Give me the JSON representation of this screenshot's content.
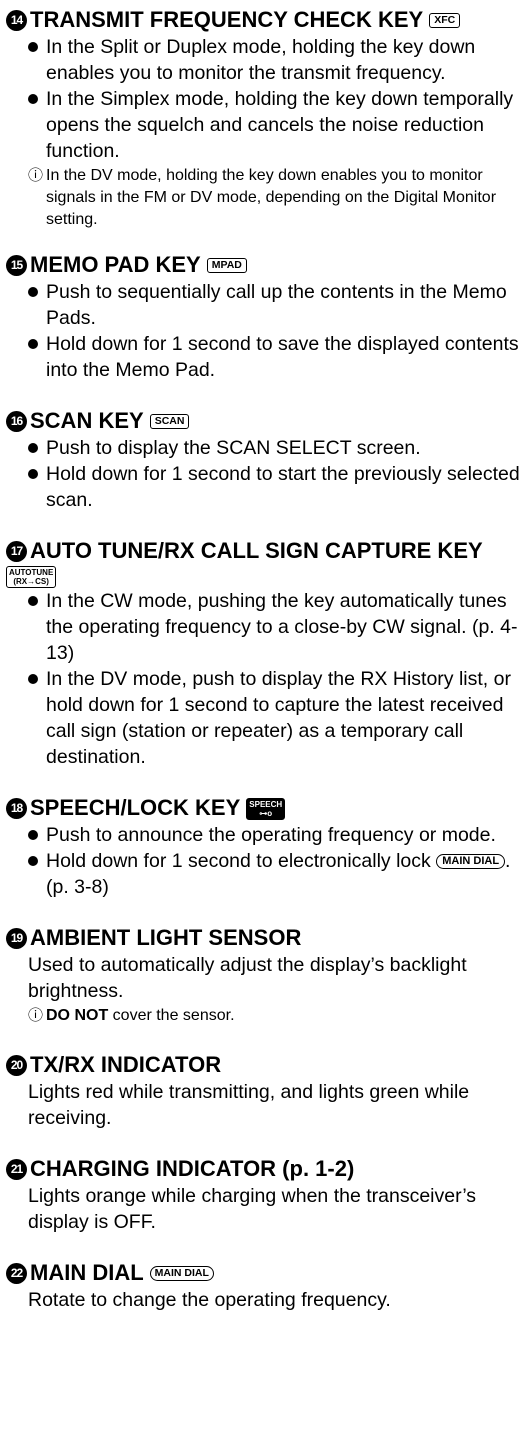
{
  "sections": [
    {
      "number": "14",
      "title": "TRANSMIT FREQUENCY CHECK KEY",
      "key": "XFC",
      "bullets": [
        "In the Split or Duplex mode, holding the key down enables you to monitor the transmit frequency.",
        "In the Simplex mode, holding the key down temporally opens the squelch and cancels the noise reduction function."
      ],
      "note": "In the DV mode, holding the key down enables you to monitor signals in the FM or DV mode, depending on the Digital Monitor setting."
    },
    {
      "number": "15",
      "title": "MEMO PAD KEY",
      "key": "MPAD",
      "bullets": [
        "Push to sequentially call up the contents in the Memo Pads.",
        "Hold down for 1 second to save the displayed contents into the Memo Pad."
      ]
    },
    {
      "number": "16",
      "title": "SCAN KEY",
      "key": "SCAN",
      "bullets": [
        "Push to display the SCAN SELECT screen.",
        "Hold down for 1 second to start the previously selected scan."
      ]
    },
    {
      "number": "17",
      "title": "AUTO TUNE/RX CALL SIGN CAPTURE KEY",
      "key_top": "AUTOTUNE",
      "key_bottom": "(RX→CS)",
      "bullets": [
        "In the CW mode, pushing the key automatically tunes the operating frequency to a close-by CW signal. (p. 4-13)",
        "In the DV mode, push to display the RX History list, or hold down for 1 second to capture the latest received call sign (station or repeater) as a temporary call destination."
      ]
    },
    {
      "number": "18",
      "title": "SPEECH/LOCK KEY",
      "key_top": "SPEECH",
      "key_bottom": "⊶o",
      "bullets": [
        "Push to announce the operating frequency or mode."
      ],
      "bullet2_pre": "Hold down for 1 second to electronically lock",
      "bullet2_key": "MAIN DIAL",
      "bullet2_post": ". (p. 3-8)"
    },
    {
      "number": "19",
      "title": "AMBIENT LIGHT SENSOR",
      "text": "Used to automatically adjust the display’s backlight brightness.",
      "note_bold": "DO NOT",
      "note_rest": " cover the sensor."
    },
    {
      "number": "20",
      "title": "TX/RX INDICATOR",
      "text": "Lights red while transmitting, and lights green while receiving."
    },
    {
      "number": "21",
      "title": "CHARGING INDICATOR (p. 1-2)",
      "text": "Lights orange while charging when the transceiver’s display is OFF."
    },
    {
      "number": "22",
      "title": "MAIN DIAL",
      "key": "MAIN DIAL",
      "text": "Rotate to change the operating frequency."
    }
  ],
  "icons": {
    "note": "info-circle-icon",
    "bullet": "bullet-dot-icon"
  }
}
